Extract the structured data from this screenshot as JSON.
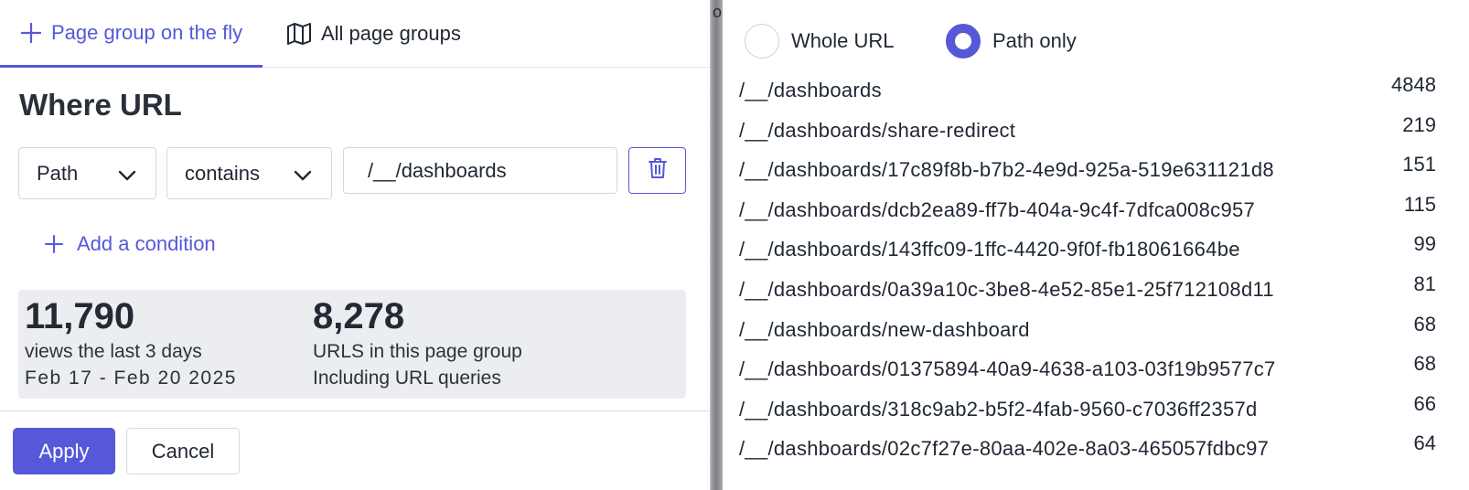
{
  "tabs": {
    "on_the_fly": "Page group on the fly",
    "all_groups": "All page groups"
  },
  "title": "Where URL",
  "condition": {
    "field": "Path",
    "operator": "contains",
    "value": "/__/dashboards"
  },
  "add_condition_label": "Add a condition",
  "stats": {
    "views": {
      "number": "11,790",
      "line1": "views the last 3 days",
      "line2": "Feb 17 - Feb 20 2025"
    },
    "urls": {
      "number": "8,278",
      "line1": "URLS in this page group",
      "line2": "Including URL queries"
    }
  },
  "buttons": {
    "apply": "Apply",
    "cancel": "Cancel"
  },
  "divider_fragment": "o",
  "radio": {
    "whole_url": "Whole URL",
    "path_only": "Path only",
    "selected": "path_only"
  },
  "url_list": [
    {
      "url": "/__/dashboards",
      "count": "4848"
    },
    {
      "url": "/__/dashboards/share-redirect",
      "count": "219"
    },
    {
      "url": "/__/dashboards/17c89f8b-b7b2-4e9d-925a-519e631121d8",
      "count": "151"
    },
    {
      "url": "/__/dashboards/dcb2ea89-ff7b-404a-9c4f-7dfca008c957",
      "count": "115"
    },
    {
      "url": "/__/dashboards/143ffc09-1ffc-4420-9f0f-fb18061664be",
      "count": "99"
    },
    {
      "url": "/__/dashboards/0a39a10c-3be8-4e52-85e1-25f712108d11",
      "count": "81"
    },
    {
      "url": "/__/dashboards/new-dashboard",
      "count": "68"
    },
    {
      "url": "/__/dashboards/01375894-40a9-4638-a103-03f19b9577c7",
      "count": "68"
    },
    {
      "url": "/__/dashboards/318c9ab2-b5f2-4fab-9560-c7036ff2357d",
      "count": "66"
    },
    {
      "url": "/__/dashboards/02c7f27e-80aa-402e-8a03-465057fdbc97",
      "count": "64"
    }
  ],
  "colors": {
    "accent": "#5558d9",
    "stats_bg": "#ebedf0"
  }
}
